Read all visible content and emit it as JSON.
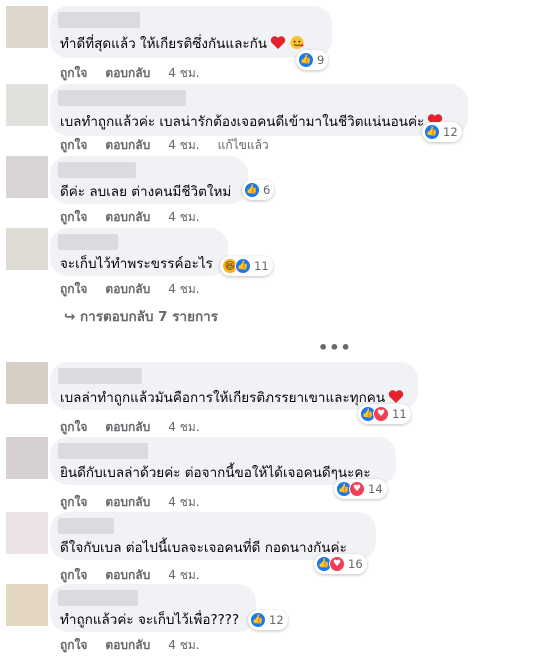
{
  "colors": {
    "bubble": "#f0f2f5",
    "like": "#1877f2",
    "love": "#f33e58",
    "meta": "#65676b"
  },
  "comments": [
    {
      "text": "ทำดีที่สุดแล้ว ให้เกียรติซึ่งกันและกัน",
      "emoji": [
        "heart",
        "hug"
      ],
      "reactions": [
        "like"
      ],
      "count": "9",
      "actions": {
        "like": "ถูกใจ",
        "reply": "ตอบกลับ",
        "time": "4 ชม."
      }
    },
    {
      "text": "เบลทำถูกแล้วค่ะ เบลน่ารักต้องเจอคนดีเข้ามาในชีวิตแน่นอนค่ะ",
      "emoji": [
        "heart"
      ],
      "reactions": [
        "like"
      ],
      "count": "12",
      "actions": {
        "like": "ถูกใจ",
        "reply": "ตอบกลับ",
        "time": "4 ชม.",
        "edited": "แก้ไขแล้ว"
      }
    },
    {
      "text": "ดีค่ะ ลบเลย ต่างคนมีชีวิตใหม่",
      "emoji": [],
      "reactions": [
        "like"
      ],
      "count": "6",
      "actions": {
        "like": "ถูกใจ",
        "reply": "ตอบกลับ",
        "time": "4 ชม."
      }
    },
    {
      "text": "จะเก็บไว้ทำพระขรรค์อะไร",
      "emoji": [],
      "reactions": [
        "haha",
        "like"
      ],
      "count": "11",
      "actions": {
        "like": "ถูกใจ",
        "reply": "ตอบกลับ",
        "time": "4 ชม."
      }
    },
    {
      "text": "เบลล่าทำถูกแล้วมันคือการให้เกียรติภรรยาเขาและทุกคน",
      "emoji": [
        "heart"
      ],
      "reactions": [
        "like",
        "love"
      ],
      "count": "11",
      "actions": {
        "like": "ถูกใจ",
        "reply": "ตอบกลับ",
        "time": "4 ชม."
      }
    },
    {
      "text": "ยินดีกับเบลล่าด้วยค่ะ ต่อจากนี้ขอให้ได้เจอคนดีๆนะคะ",
      "emoji": [],
      "reactions": [
        "like",
        "love"
      ],
      "count": "14",
      "actions": {
        "like": "ถูกใจ",
        "reply": "ตอบกลับ",
        "time": "4 ชม."
      }
    },
    {
      "text": "ดีใจกับเบล ต่อไปนี้เบลจะเจอคนที่ดี กอดนางกันค่ะ",
      "emoji": [],
      "reactions": [
        "like",
        "love"
      ],
      "count": "16",
      "actions": {
        "like": "ถูกใจ",
        "reply": "ตอบกลับ",
        "time": "4 ชม."
      }
    },
    {
      "text": "ทำถูกแล้วค่ะ จะเก็บไว้เพื่อ????",
      "emoji": [],
      "reactions": [
        "like"
      ],
      "count": "12",
      "actions": {
        "like": "ถูกใจ",
        "reply": "ตอบกลับ",
        "time": "4 ชม."
      }
    }
  ],
  "replies_link": "↪ การตอบกลับ 7 รายการ",
  "more_icon": "more-horizontal-icon",
  "more_label": "•••"
}
